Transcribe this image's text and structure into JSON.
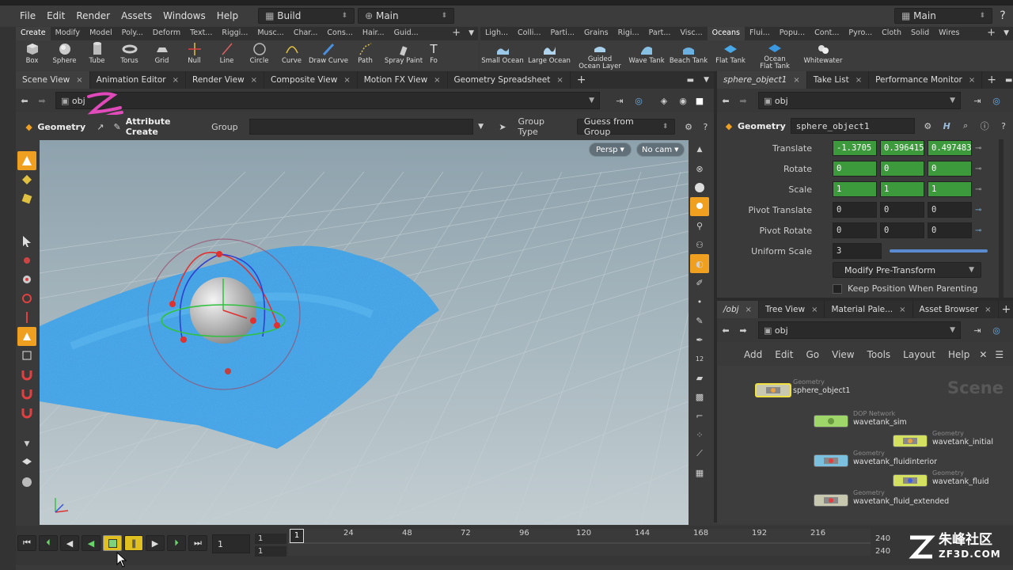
{
  "menubar": {
    "items": [
      "File",
      "Edit",
      "Render",
      "Assets",
      "Windows",
      "Help"
    ],
    "desktop": "Build",
    "context": "Main",
    "right_desktop": "Main"
  },
  "shelf_left": {
    "tabs": [
      "Create",
      "Modify",
      "Model",
      "Poly...",
      "Deform",
      "Text...",
      "Riggi...",
      "Musc...",
      "Char...",
      "Cons...",
      "Hair...",
      "Guid..."
    ],
    "tools": [
      "Box",
      "Sphere",
      "Tube",
      "Torus",
      "Grid",
      "Null",
      "Line",
      "Circle",
      "Curve",
      "Draw Curve",
      "Path",
      "Spray Paint",
      "Fo"
    ]
  },
  "shelf_right": {
    "tabs": [
      "Ligh...",
      "Colli...",
      "Parti...",
      "Grains",
      "Rigi...",
      "Part...",
      "Visc...",
      "Oceans",
      "Flui...",
      "Popu...",
      "Cont...",
      "Pyro...",
      "Cloth",
      "Solid",
      "Wires"
    ],
    "tools": [
      "Small Ocean",
      "Large Ocean",
      "Guided Ocean Layer",
      "Wave Tank",
      "Beach Tank",
      "Flat Tank",
      "Ocean Flat Tank",
      "Whitewater"
    ]
  },
  "left_panel": {
    "tabs": [
      "Scene View",
      "Animation Editor",
      "Render View",
      "Composite View",
      "Motion FX View",
      "Geometry Spreadsheet"
    ],
    "path": "obj",
    "op": {
      "context": "Geometry",
      "tool": "Attribute Create",
      "group_label": "Group",
      "group_type_label": "Group Type",
      "group_type_value": "Guess from Group"
    },
    "viewport": {
      "camera_menu": "Persp",
      "cam_menu": "No cam"
    }
  },
  "params": {
    "tabs": [
      "sphere_object1",
      "Take List",
      "Performance Monitor"
    ],
    "path": "obj",
    "node_type": "Geometry",
    "node_name": "sphere_object1",
    "rows": [
      {
        "label": "Translate",
        "values": [
          "-1.3705",
          "0.396415",
          "0.497483"
        ],
        "style": "green"
      },
      {
        "label": "Rotate",
        "values": [
          "0",
          "0",
          "0"
        ],
        "style": "green"
      },
      {
        "label": "Scale",
        "values": [
          "1",
          "1",
          "1"
        ],
        "style": "green"
      },
      {
        "label": "Pivot Translate",
        "values": [
          "0",
          "0",
          "0"
        ],
        "style": "dark"
      },
      {
        "label": "Pivot Rotate",
        "values": [
          "0",
          "0",
          "0"
        ],
        "style": "dark"
      }
    ],
    "uniform_scale_label": "Uniform Scale",
    "uniform_scale": "3",
    "modify_pretransform": "Modify Pre-Transform",
    "keep_position": "Keep Position When Parenting"
  },
  "network": {
    "tabs": [
      "/obj",
      "Tree View",
      "Material Pale...",
      "Asset Browser"
    ],
    "path": "obj",
    "menu": [
      "Add",
      "Edit",
      "Go",
      "View",
      "Tools",
      "Layout",
      "Help"
    ],
    "watermark": "Scene",
    "nodes": [
      {
        "type": "Geometry",
        "name": "sphere_object1",
        "color": "#c8c8b0"
      },
      {
        "type": "DOP Network",
        "name": "wavetank_sim",
        "color": "#9ed66a"
      },
      {
        "type": "Geometry",
        "name": "wavetank_initial",
        "color": "#d4e060"
      },
      {
        "type": "Geometry",
        "name": "wavetank_fluidinterior",
        "color": "#7cc0e0"
      },
      {
        "type": "Geometry",
        "name": "wavetank_fluid",
        "color": "#d4e060"
      },
      {
        "type": "Geometry",
        "name": "wavetank_fluid_extended",
        "color": "#c8c8b0"
      }
    ]
  },
  "timeline": {
    "current_frame": "1",
    "start": "1",
    "start2": "1",
    "end": "240",
    "end2": "240",
    "ticks": [
      "1",
      "24",
      "48",
      "72",
      "96",
      "120",
      "144",
      "168",
      "192",
      "216",
      "240"
    ]
  },
  "watermark": {
    "cn": "朱峰社区",
    "url": "ZF3D.COM"
  },
  "colors": {
    "accent": "#f0a020",
    "param_green": "#3c9a3c",
    "fluid": "#3aa0e8"
  }
}
